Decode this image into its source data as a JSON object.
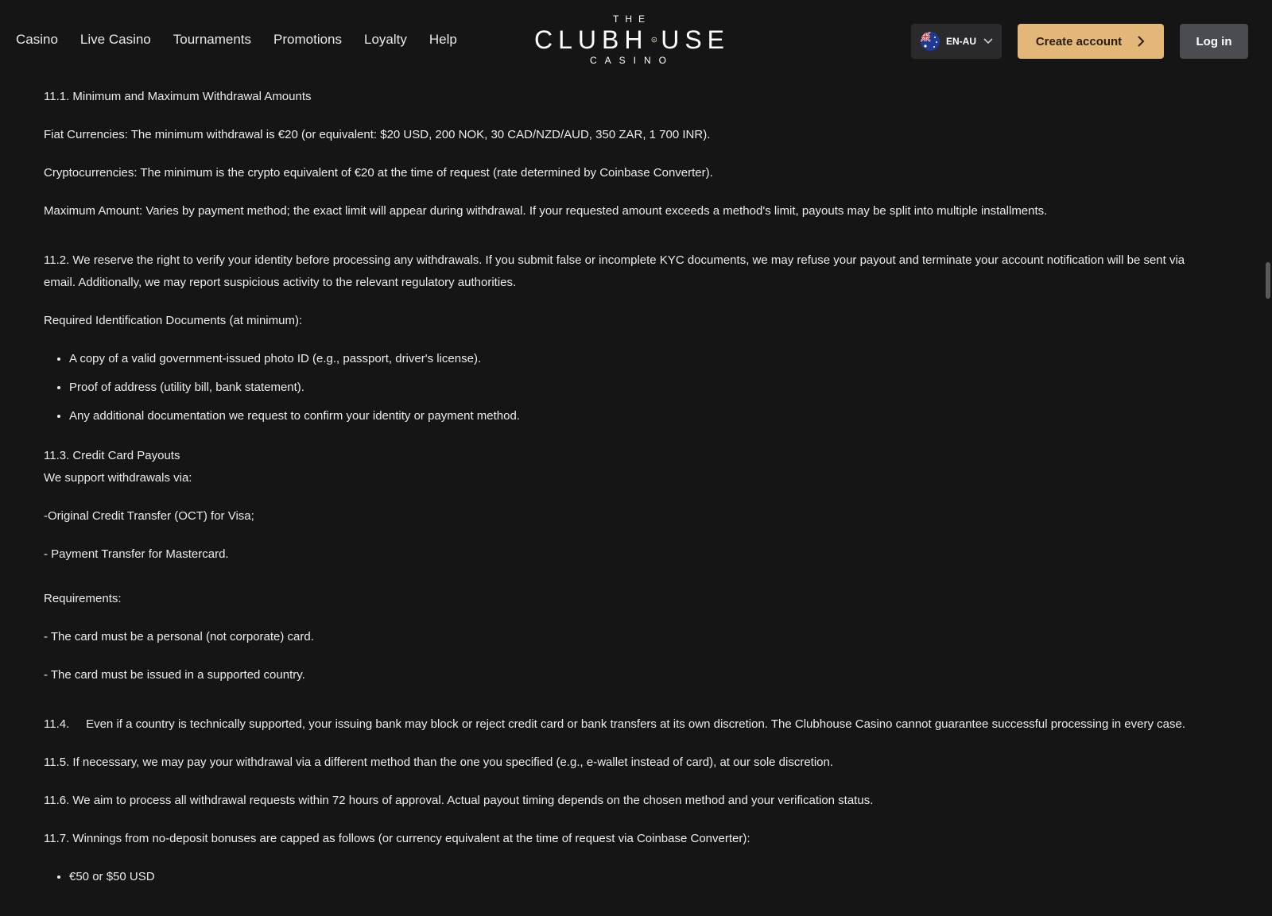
{
  "nav": {
    "items": [
      "Casino",
      "Live Casino",
      "Tournaments",
      "Promotions",
      "Loyalty",
      "Help"
    ]
  },
  "logo": {
    "top": "THE",
    "main_left": "CLUBH",
    "main_right": "USE",
    "bottom": "CASINO"
  },
  "header": {
    "language": "EN-AU",
    "create_account": "Create account",
    "login": "Log in"
  },
  "colors": {
    "background": "#151515",
    "accent": "#e2b778",
    "login_bg": "#4b4c52"
  },
  "content": {
    "s11_1_title": "11.1. Minimum and Maximum Withdrawal Amounts",
    "s11_1_fiat": "Fiat Currencies: The minimum withdrawal is €20 (or equivalent: $20 USD, 200 NOK, 30 CAD/NZD/AUD, 350 ZAR, 1 700 INR).",
    "s11_1_crypto": "Cryptocurrencies: The minimum is the crypto equivalent of €20 at the time of request (rate determined by Coinbase Converter).",
    "s11_1_max": "Maximum Amount: Varies by payment method; the exact limit will appear during withdrawal. If your requested amount exceeds a method's limit, payouts may be split into multiple installments.",
    "s11_2": "11.2. We reserve the right to verify your identity before processing any withdrawals. If you submit false or incomplete KYC documents, we may refuse your payout and terminate your account notification will be sent via email. Additionally, we may report suspicious activity to the relevant regulatory authorities.",
    "s11_2_docs_title": "Required Identification Documents (at minimum):",
    "s11_2_docs": [
      "A copy of a valid government-issued photo ID (e.g., passport, driver's license).",
      "Proof of address (utility bill, bank statement).",
      "Any additional documentation we request to confirm your identity or payment method."
    ],
    "s11_3_title": "11.3. Credit Card Payouts",
    "s11_3_intro": "We support withdrawals via:",
    "s11_3_oct": "-Original Credit Transfer (OCT) for Visa;",
    "s11_3_pt": "- Payment Transfer for Mastercard.",
    "s11_3_req_title": "Requirements:",
    "s11_3_req1": "-  The card must be a personal (not corporate) card.",
    "s11_3_req2": "- The card must be issued in a supported country.",
    "s11_4": "11.4.     Even if a country is technically supported, your issuing bank may block or reject credit card or bank transfers at its own discretion. The Clubhouse Casino cannot guarantee successful processing in every case.",
    "s11_5": "11.5. If necessary, we may pay your withdrawal via a different method than the one you specified (e.g., e-wallet instead of card), at our sole discretion.",
    "s11_6": "11.6. We aim to process all withdrawal requests within 72 hours of approval. Actual payout timing depends on the chosen method and your verification status.",
    "s11_7": "11.7. Winnings from no-deposit bonuses are capped as follows (or currency equivalent at the time of request via Coinbase Converter):",
    "s11_7_caps": [
      "€50 or $50 USD"
    ]
  }
}
